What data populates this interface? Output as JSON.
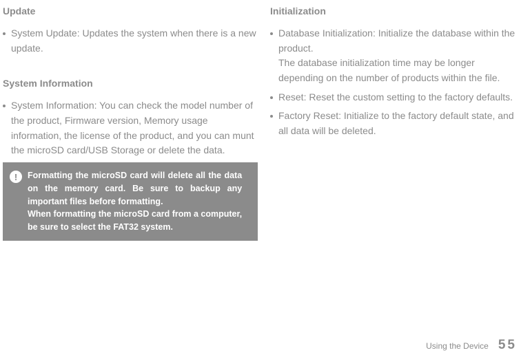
{
  "left": {
    "update": {
      "title": "Update",
      "items": [
        "System Update: Updates the system when there is a new update."
      ]
    },
    "sysinfo": {
      "title": "System Information",
      "items": [
        "System Information: You can check the model number of the product, Firmware version, Memory usage information, the license of the product, and you can munt the microSD card/USB Storage or delete the data."
      ]
    },
    "warning": {
      "icon": "!",
      "line1": "Formatting the microSD card will delete all the data",
      "line2": "on the memory card. Be sure to backup any",
      "line3": "important files before formatting.",
      "line4": "When formatting the microSD card from a computer,",
      "line5": "be sure to select the FAT32 system."
    }
  },
  "right": {
    "init": {
      "title": "Initialization",
      "items": [
        "Database Initialization: Initialize the database within the product.\nThe database initialization time may be longer depending on the number of products within the file.",
        "Reset: Reset the custom setting to the factory defaults.",
        "Factory Reset: Initialize to the factory default state, and all data will be deleted."
      ]
    }
  },
  "footer": {
    "label": "Using the Device",
    "page": "55"
  }
}
